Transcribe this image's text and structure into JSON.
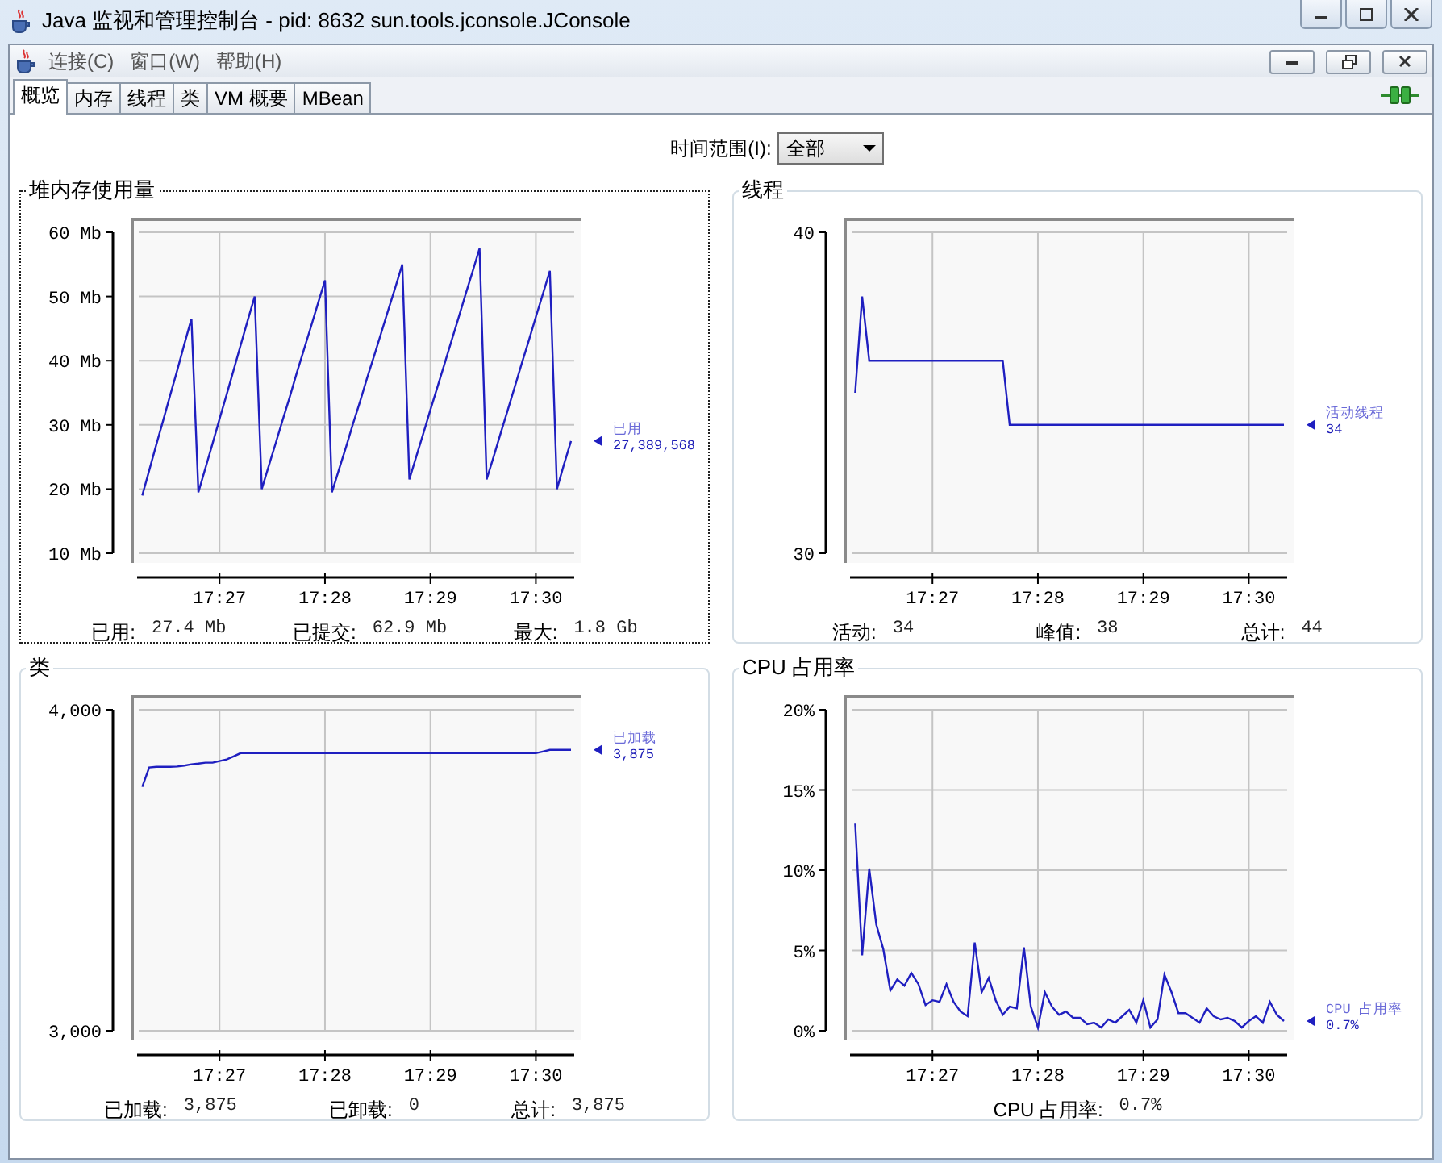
{
  "window": {
    "title": "Java 监视和管理控制台 - pid: 8632 sun.tools.jconsole.JConsole"
  },
  "menu": [
    "连接(C)",
    "窗口(W)",
    "帮助(H)"
  ],
  "tabs": [
    {
      "label": "概览",
      "selected": true
    },
    {
      "label": "内存",
      "selected": false
    },
    {
      "label": "线程",
      "selected": false
    },
    {
      "label": "类",
      "selected": false
    },
    {
      "label": "VM 概要",
      "selected": false
    },
    {
      "label": "MBean",
      "selected": false
    }
  ],
  "time_range": {
    "label": "时间范围(I):",
    "value": "全部"
  },
  "panels": [
    {
      "title": "堆内存使用量",
      "focused": true,
      "legend_value": "27,389,568",
      "chart_data": {
        "type": "line",
        "categories": [
          null,
          null,
          null,
          null,
          null,
          null,
          null,
          null,
          null,
          null,
          null,
          "17:27",
          null,
          null,
          null,
          null,
          null,
          null,
          null,
          null,
          null,
          null,
          null,
          null,
          null,
          null,
          "17:28",
          null,
          null,
          null,
          null,
          null,
          null,
          null,
          null,
          null,
          null,
          null,
          null,
          null,
          null,
          "17:29",
          null,
          null,
          null,
          null,
          null,
          null,
          null,
          null,
          null,
          null,
          null,
          null,
          null,
          null,
          "17:30",
          null,
          null,
          null,
          null,
          null
        ],
        "series": [
          {
            "name": "已用",
            "color": "#1f1fc0",
            "values": [
              19,
              22.9,
              26.9,
              30.8,
              34.7,
              38.6,
              42.6,
              46.5,
              19.5,
              23.3,
              27.1,
              30.9,
              34.7,
              38.5,
              42.4,
              46.2,
              50,
              20,
              23.6,
              27.2,
              30.8,
              34.4,
              38.1,
              41.7,
              45.3,
              48.9,
              52.5,
              19.5,
              23.1,
              26.6,
              30.2,
              33.7,
              37.3,
              40.8,
              44.3,
              47.9,
              51.4,
              55,
              21.5,
              25.1,
              28.7,
              32.3,
              35.9,
              39.5,
              43.1,
              46.7,
              50.3,
              53.9,
              57.5,
              21.5,
              25.1,
              28.7,
              32.3,
              35.9,
              39.6,
              43.2,
              46.8,
              50.4,
              54,
              20,
              23.8,
              27.5
            ]
          }
        ],
        "ylim": [
          10,
          60
        ],
        "grid": true,
        "yticks": [
          {
            "value": 10,
            "label": "10 Mb"
          },
          {
            "value": 20,
            "label": "20 Mb"
          },
          {
            "value": 30,
            "label": "30 Mb"
          },
          {
            "value": 40,
            "label": "40 Mb"
          },
          {
            "value": 50,
            "label": "50 Mb"
          },
          {
            "value": 60,
            "label": "60 Mb"
          }
        ]
      },
      "stats": [
        {
          "label": "已用:",
          "value": "27.4 Mb"
        },
        {
          "label": "已提交:",
          "value": "62.9 Mb"
        },
        {
          "label": "最大:",
          "value": "1.8 Gb"
        }
      ]
    },
    {
      "title": "线程",
      "focused": false,
      "legend_value": "34",
      "chart_data": {
        "type": "line",
        "categories": [
          null,
          null,
          null,
          null,
          null,
          null,
          null,
          null,
          null,
          null,
          null,
          "17:27",
          null,
          null,
          null,
          null,
          null,
          null,
          null,
          null,
          null,
          null,
          null,
          null,
          null,
          null,
          "17:28",
          null,
          null,
          null,
          null,
          null,
          null,
          null,
          null,
          null,
          null,
          null,
          null,
          null,
          null,
          "17:29",
          null,
          null,
          null,
          null,
          null,
          null,
          null,
          null,
          null,
          null,
          null,
          null,
          null,
          null,
          "17:30",
          null,
          null,
          null,
          null,
          null
        ],
        "series": [
          {
            "name": "活动线程",
            "color": "#1f1fc0",
            "values": [
              35,
              38,
              36,
              36,
              36,
              36,
              36,
              36,
              36,
              36,
              36,
              36,
              36,
              36,
              36,
              36,
              36,
              36,
              36,
              36,
              36,
              36,
              34,
              34,
              34,
              34,
              34,
              34,
              34,
              34,
              34,
              34,
              34,
              34,
              34,
              34,
              34,
              34,
              34,
              34,
              34,
              34,
              34,
              34,
              34,
              34,
              34,
              34,
              34,
              34,
              34,
              34,
              34,
              34,
              34,
              34,
              34,
              34,
              34,
              34,
              34,
              34
            ]
          }
        ],
        "ylim": [
          30,
          40
        ],
        "grid": true,
        "yticks": [
          30,
          40
        ]
      },
      "stats": [
        {
          "label": "活动:",
          "value": "34"
        },
        {
          "label": "峰值:",
          "value": "38"
        },
        {
          "label": "总计:",
          "value": "44"
        }
      ]
    },
    {
      "title": "类",
      "focused": false,
      "legend_value": "3,875",
      "chart_data": {
        "type": "line",
        "categories": [
          null,
          null,
          null,
          null,
          null,
          null,
          null,
          null,
          null,
          null,
          null,
          "17:27",
          null,
          null,
          null,
          null,
          null,
          null,
          null,
          null,
          null,
          null,
          null,
          null,
          null,
          null,
          "17:28",
          null,
          null,
          null,
          null,
          null,
          null,
          null,
          null,
          null,
          null,
          null,
          null,
          null,
          null,
          "17:29",
          null,
          null,
          null,
          null,
          null,
          null,
          null,
          null,
          null,
          null,
          null,
          null,
          null,
          null,
          "17:30",
          null,
          null,
          null,
          null,
          null
        ],
        "series": [
          {
            "name": "已加载",
            "color": "#1f1fc0",
            "values": [
              3760,
              3820,
              3822,
              3822,
              3822,
              3823,
              3826,
              3830,
              3832,
              3835,
              3835,
              3840,
              3845,
              3855,
              3865,
              3865,
              3865,
              3865,
              3865,
              3865,
              3865,
              3865,
              3865,
              3865,
              3865,
              3865,
              3865,
              3865,
              3865,
              3865,
              3865,
              3865,
              3865,
              3865,
              3865,
              3865,
              3865,
              3865,
              3865,
              3865,
              3865,
              3865,
              3865,
              3865,
              3865,
              3865,
              3865,
              3865,
              3865,
              3865,
              3865,
              3865,
              3865,
              3865,
              3865,
              3865,
              3865,
              3870,
              3875,
              3875,
              3875,
              3875
            ]
          }
        ],
        "ylim": [
          3000,
          4000
        ],
        "grid": true,
        "yticks": [
          {
            "value": 3000,
            "label": "3,000"
          },
          {
            "value": 4000,
            "label": "4,000"
          }
        ]
      },
      "stats": [
        {
          "label": "已加载:",
          "value": "3,875"
        },
        {
          "label": "已卸载:",
          "value": "0"
        },
        {
          "label": "总计:",
          "value": "3,875"
        }
      ]
    },
    {
      "title": "CPU 占用率",
      "focused": false,
      "legend_value": "0.7%",
      "chart_data": {
        "type": "line",
        "categories": [
          null,
          null,
          null,
          null,
          null,
          null,
          null,
          null,
          null,
          null,
          null,
          "17:27",
          null,
          null,
          null,
          null,
          null,
          null,
          null,
          null,
          null,
          null,
          null,
          null,
          null,
          null,
          "17:28",
          null,
          null,
          null,
          null,
          null,
          null,
          null,
          null,
          null,
          null,
          null,
          null,
          null,
          null,
          "17:29",
          null,
          null,
          null,
          null,
          null,
          null,
          null,
          null,
          null,
          null,
          null,
          null,
          null,
          null,
          "17:30",
          null,
          null,
          null,
          null,
          null
        ],
        "series": [
          {
            "name": "CPU 占用率",
            "color": "#1f1fc0",
            "values": [
              12.9,
              4.7,
              10.1,
              6.6,
              5.1,
              2.5,
              3.2,
              2.8,
              3.6,
              2.9,
              1.6,
              1.9,
              1.8,
              2.9,
              1.8,
              1.2,
              0.9,
              5.5,
              2.4,
              3.3,
              1.9,
              1.0,
              1.5,
              1.4,
              5.2,
              1.5,
              0.2,
              2.4,
              1.5,
              1.0,
              1.2,
              0.8,
              0.8,
              0.4,
              0.5,
              0.2,
              0.7,
              0.5,
              0.9,
              1.3,
              0.5,
              1.9,
              0.2,
              0.7,
              3.5,
              2.4,
              1.1,
              1.1,
              0.8,
              0.5,
              1.4,
              0.9,
              0.7,
              0.8,
              0.6,
              0.2,
              0.6,
              0.9,
              0.5,
              1.8,
              1.0,
              0.6
            ]
          }
        ],
        "ylim": [
          0,
          20
        ],
        "grid": true,
        "yticks": [
          {
            "value": 0,
            "label": "0%"
          },
          {
            "value": 5,
            "label": "5%"
          },
          {
            "value": 10,
            "label": "10%"
          },
          {
            "value": 15,
            "label": "15%"
          },
          {
            "value": 20,
            "label": "20%"
          }
        ]
      },
      "stats": [
        {
          "label": "CPU 占用率:",
          "value": "0.7%"
        }
      ]
    }
  ]
}
